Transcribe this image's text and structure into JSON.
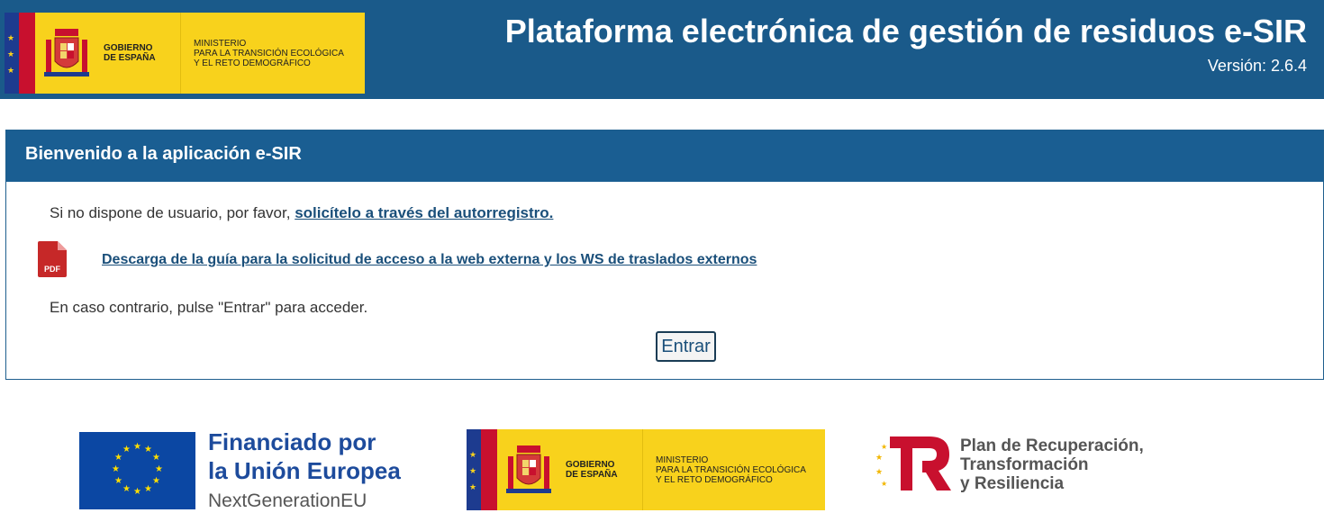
{
  "header": {
    "title": "Plataforma electrónica de gestión de residuos e-SIR",
    "version": "Versión: 2.6.4",
    "logo": {
      "gobierno": "GOBIERNO\nDE ESPAÑA",
      "ministerio": "MINISTERIO\nPARA LA TRANSICIÓN ECOLÓGICA\nY EL RETO DEMOGRÁFICO"
    }
  },
  "welcome": {
    "heading": "Bienvenido a la aplicación e-SIR",
    "no_user_text": "Si no dispone de usuario, por favor, ",
    "register_link": "solicítelo a través del autorregistro.",
    "pdf_icon_label": "PDF",
    "guide_link": "Descarga de la guía para la solicitud de acceso a la web externa y los WS de traslados externos",
    "otherwise_text": "En caso contrario, pulse \"Entrar\" para acceder.",
    "enter_button": "Entrar"
  },
  "footer": {
    "eu_line1": "Financiado por",
    "eu_line2": "la Unión Europea",
    "eu_line3": "NextGenerationEU",
    "gov_logo": {
      "gobierno": "GOBIERNO\nDE ESPAÑA",
      "ministerio": "MINISTERIO\nPARA LA TRANSICIÓN ECOLÓGICA\nY EL RETO DEMOGRÁFICO"
    },
    "prtr_text": "Plan de Recuperación,\nTransformación\ny Resiliencia"
  },
  "colors": {
    "header_bg": "#1a5a8a",
    "panel_head_bg": "#1a5e92",
    "link": "#1a4f7a",
    "gov_yellow": "#f8d21c",
    "eu_blue": "#0b47a3"
  }
}
